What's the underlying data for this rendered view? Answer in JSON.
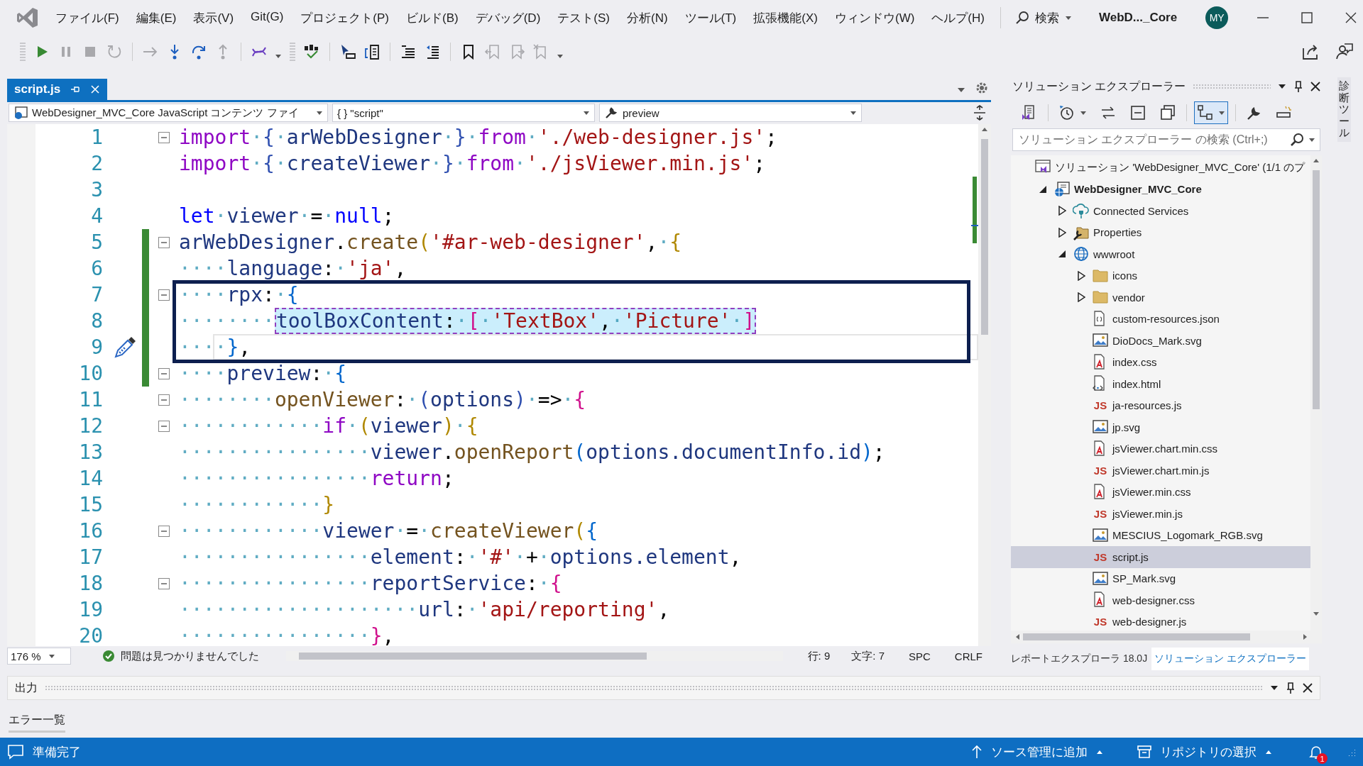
{
  "menu_bar": {
    "items": [
      "ファイル(F)",
      "編集(E)",
      "表示(V)",
      "Git(G)",
      "プロジェクト(P)",
      "ビルド(B)",
      "デバッグ(D)",
      "テスト(S)",
      "分析(N)",
      "ツール(T)",
      "拡張機能(X)",
      "ウィンドウ(W)",
      "ヘルプ(H)"
    ],
    "search": "検索",
    "title": "WebD..._Core",
    "avatar": "MY"
  },
  "toolbar": [
    {
      "disabled": false
    },
    {
      "disabled": true
    },
    {
      "disabled": true
    },
    {
      "disabled": true
    },
    {
      "disabled": true
    },
    {
      "disabled": false
    },
    {
      "disabled": false
    },
    {
      "disabled": true
    },
    {
      "disabled": false
    },
    {
      "disabled": false
    },
    {
      "disabled": false
    },
    {
      "disabled": false
    },
    {
      "disabled": false
    },
    {
      "disabled": false
    },
    {
      "disabled": false
    },
    {
      "disabled": true
    },
    {
      "disabled": true
    },
    {
      "disabled": true
    }
  ],
  "document_tab": {
    "label": "script.js",
    "selected": true
  },
  "navigation_bar": {
    "project": "WebDesigner_MVC_Core JavaScript コンテンツ ファイ",
    "scope": "{ } \"script\"",
    "member": "preview"
  },
  "code_lines": [
    {
      "number": "1",
      "fold": true,
      "changed": false,
      "highlight": false,
      "current": false,
      "tokens": [
        {
          "kind": "kw",
          "text": "import"
        },
        {
          "kind": "p",
          "text": "·"
        },
        {
          "kind": "b3",
          "text": "{"
        },
        {
          "kind": "id",
          "text": "·arWebDesigner·"
        },
        {
          "kind": "b3",
          "text": "}"
        },
        {
          "kind": "p",
          "text": "·"
        },
        {
          "kind": "kw",
          "text": "from"
        },
        {
          "kind": "p",
          "text": "·"
        },
        {
          "kind": "str",
          "text": "'./web-designer.js'"
        },
        {
          "kind": "p",
          "text": ";"
        }
      ]
    },
    {
      "number": "2",
      "fold": false,
      "changed": false,
      "highlight": false,
      "current": false,
      "tokens": [
        {
          "kind": "kw",
          "text": "import"
        },
        {
          "kind": "p",
          "text": "·"
        },
        {
          "kind": "b3",
          "text": "{"
        },
        {
          "kind": "id",
          "text": "·createViewer·"
        },
        {
          "kind": "b3",
          "text": "}"
        },
        {
          "kind": "p",
          "text": "·"
        },
        {
          "kind": "kw",
          "text": "from"
        },
        {
          "kind": "p",
          "text": "·"
        },
        {
          "kind": "str",
          "text": "'./jsViewer.min.js'"
        },
        {
          "kind": "p",
          "text": ";"
        }
      ]
    },
    {
      "number": "3",
      "fold": false,
      "changed": false,
      "highlight": false,
      "current": false
    },
    {
      "number": "4",
      "fold": false,
      "changed": false,
      "highlight": false,
      "current": false,
      "tokens": [
        {
          "kind": "kw2",
          "text": "let"
        },
        {
          "kind": "id",
          "text": "·viewer·"
        },
        {
          "kind": "p",
          "text": "=·"
        },
        {
          "kind": "kw2",
          "text": "null"
        },
        {
          "kind": "p",
          "text": ";"
        }
      ]
    },
    {
      "number": "5",
      "fold": true,
      "changed": true,
      "highlight": false,
      "current": false,
      "tokens": [
        {
          "kind": "id",
          "text": "arWebDesigner"
        },
        {
          "kind": "p",
          "text": "."
        },
        {
          "kind": "fn",
          "text": "create"
        },
        {
          "kind": "b1",
          "text": "("
        },
        {
          "kind": "str",
          "text": "'#ar-web-designer'"
        },
        {
          "kind": "p",
          "text": ",·"
        },
        {
          "kind": "b1",
          "text": "{"
        }
      ]
    },
    {
      "number": "6",
      "fold": false,
      "changed": true,
      "highlight": false,
      "current": false,
      "tokens": [
        {
          "kind": "ws",
          "text": "····"
        },
        {
          "kind": "id",
          "text": "language"
        },
        {
          "kind": "p",
          "text": ":·"
        },
        {
          "kind": "str",
          "text": "'ja'"
        },
        {
          "kind": "p",
          "text": ","
        }
      ]
    },
    {
      "number": "7",
      "fold": true,
      "changed": true,
      "highlight": false,
      "current": false,
      "tokens": [
        {
          "kind": "ws",
          "text": "····"
        },
        {
          "kind": "id",
          "text": "rpx"
        },
        {
          "kind": "p",
          "text": ":·"
        },
        {
          "kind": "b2",
          "text": "{"
        }
      ]
    },
    {
      "number": "8",
      "fold": false,
      "changed": true,
      "highlight": true,
      "current": false,
      "tokens": [
        {
          "kind": "ws",
          "text": "········"
        },
        {
          "kind": "id",
          "text": "toolBoxContent"
        },
        {
          "kind": "p",
          "text": ":·"
        },
        {
          "kind": "b4",
          "text": "["
        },
        {
          "kind": "p",
          "text": "·"
        },
        {
          "kind": "str",
          "text": "'TextBox'"
        },
        {
          "kind": "p",
          "text": ",·"
        },
        {
          "kind": "str",
          "text": "'Picture'"
        },
        {
          "kind": "p",
          "text": "·"
        },
        {
          "kind": "b4",
          "text": "]"
        }
      ]
    },
    {
      "number": "9",
      "fold": false,
      "changed": true,
      "highlight": false,
      "current": true,
      "tokens": [
        {
          "kind": "ws",
          "text": "····"
        },
        {
          "kind": "b2",
          "text": "}"
        },
        {
          "kind": "p",
          "text": ","
        }
      ]
    },
    {
      "number": "10",
      "fold": true,
      "changed": true,
      "highlight": false,
      "current": false,
      "tokens": [
        {
          "kind": "ws",
          "text": "····"
        },
        {
          "kind": "id",
          "text": "preview"
        },
        {
          "kind": "p",
          "text": ":·"
        },
        {
          "kind": "b2",
          "text": "{"
        }
      ]
    },
    {
      "number": "11",
      "fold": true,
      "changed": false,
      "highlight": false,
      "current": false,
      "tokens": [
        {
          "kind": "ws",
          "text": "········"
        },
        {
          "kind": "fn",
          "text": "openViewer"
        },
        {
          "kind": "p",
          "text": ":·"
        },
        {
          "kind": "b3",
          "text": "("
        },
        {
          "kind": "id",
          "text": "options"
        },
        {
          "kind": "b3",
          "text": ")"
        },
        {
          "kind": "p",
          "text": "·=>·"
        },
        {
          "kind": "b4",
          "text": "{"
        }
      ]
    },
    {
      "number": "12",
      "fold": true,
      "changed": false,
      "highlight": false,
      "current": false,
      "tokens": [
        {
          "kind": "ws",
          "text": "············"
        },
        {
          "kind": "kw",
          "text": "if"
        },
        {
          "kind": "p",
          "text": "·"
        },
        {
          "kind": "b1",
          "text": "("
        },
        {
          "kind": "id",
          "text": "viewer"
        },
        {
          "kind": "b1",
          "text": ")"
        },
        {
          "kind": "p",
          "text": "·"
        },
        {
          "kind": "b1",
          "text": "{"
        }
      ]
    },
    {
      "number": "13",
      "fold": false,
      "changed": false,
      "highlight": false,
      "current": false,
      "tokens": [
        {
          "kind": "ws",
          "text": "················"
        },
        {
          "kind": "id",
          "text": "viewer"
        },
        {
          "kind": "p",
          "text": "."
        },
        {
          "kind": "fn",
          "text": "openReport"
        },
        {
          "kind": "b2",
          "text": "("
        },
        {
          "kind": "id",
          "text": "options.documentInfo.id"
        },
        {
          "kind": "b2",
          "text": ")"
        },
        {
          "kind": "p",
          "text": ";"
        }
      ]
    },
    {
      "number": "14",
      "fold": false,
      "changed": false,
      "highlight": false,
      "current": false,
      "tokens": [
        {
          "kind": "ws",
          "text": "················"
        },
        {
          "kind": "kw",
          "text": "return"
        },
        {
          "kind": "p",
          "text": ";"
        }
      ]
    },
    {
      "number": "15",
      "fold": false,
      "changed": false,
      "highlight": false,
      "current": false,
      "tokens": [
        {
          "kind": "ws",
          "text": "············"
        },
        {
          "kind": "b1",
          "text": "}"
        }
      ]
    },
    {
      "number": "16",
      "fold": true,
      "changed": false,
      "highlight": false,
      "current": false,
      "tokens": [
        {
          "kind": "ws",
          "text": "············"
        },
        {
          "kind": "id",
          "text": "viewer"
        },
        {
          "kind": "p",
          "text": "·=·"
        },
        {
          "kind": "fn",
          "text": "createViewer"
        },
        {
          "kind": "b1",
          "text": "("
        },
        {
          "kind": "b2",
          "text": "{"
        }
      ]
    },
    {
      "number": "17",
      "fold": false,
      "changed": false,
      "highlight": false,
      "current": false,
      "tokens": [
        {
          "kind": "ws",
          "text": "················"
        },
        {
          "kind": "id",
          "text": "element"
        },
        {
          "kind": "p",
          "text": ":·"
        },
        {
          "kind": "str",
          "text": "'#'"
        },
        {
          "kind": "p",
          "text": "·+·"
        },
        {
          "kind": "id",
          "text": "options.element"
        },
        {
          "kind": "p",
          "text": ","
        }
      ]
    },
    {
      "number": "18",
      "fold": true,
      "changed": false,
      "highlight": false,
      "current": false,
      "tokens": [
        {
          "kind": "ws",
          "text": "················"
        },
        {
          "kind": "id",
          "text": "reportService"
        },
        {
          "kind": "p",
          "text": ":·"
        },
        {
          "kind": "b4",
          "text": "{"
        }
      ]
    },
    {
      "number": "19",
      "fold": false,
      "changed": false,
      "highlight": false,
      "current": false,
      "tokens": [
        {
          "kind": "ws",
          "text": "····················"
        },
        {
          "kind": "id",
          "text": "url"
        },
        {
          "kind": "p",
          "text": ":·"
        },
        {
          "kind": "str",
          "text": "'api/reporting'"
        },
        {
          "kind": "p",
          "text": ","
        }
      ]
    },
    {
      "number": "20",
      "fold": false,
      "changed": false,
      "highlight": false,
      "current": false,
      "tokens": [
        {
          "kind": "ws",
          "text": "················"
        },
        {
          "kind": "b4",
          "text": "}"
        },
        {
          "kind": "p",
          "text": ","
        }
      ]
    }
  ],
  "editor_status": {
    "zoom": "176 %",
    "issues": "問題は見つかりませんでした",
    "line": "行: 9",
    "column": "文字: 7",
    "indent": "SPC",
    "line_ending": "CRLF"
  },
  "solution_explorer": {
    "title": "ソリューション エクスプローラー",
    "toolbar": [
      {
        "on": false
      },
      {
        "on": false
      },
      {
        "on": false
      },
      {
        "on": false
      },
      {
        "on": false
      },
      {
        "on": true
      },
      {
        "on": false
      },
      {
        "on": false
      }
    ],
    "search": {
      "placeholder": "ソリューション エクスプローラー の検索 (Ctrl+;)"
    },
    "tree": [
      {
        "label": "ソリューション 'WebDesigner_MVC_Core' (1/1 のプ",
        "kind": "solution",
        "selected": false,
        "children": [
          {
            "label": "WebDesigner_MVC_Core",
            "kind": "project",
            "expanded": true,
            "selected": false,
            "children": [
              {
                "label": "Connected Services",
                "kind": "connected",
                "expanded": false,
                "selected": false
              },
              {
                "label": "Properties",
                "kind": "properties",
                "expanded": false,
                "selected": false
              },
              {
                "label": "wwwroot",
                "kind": "web",
                "expanded": true,
                "selected": false,
                "children": [
                  {
                    "label": "icons",
                    "kind": "folder",
                    "expanded": false,
                    "selected": false
                  },
                  {
                    "label": "vendor",
                    "kind": "folder",
                    "expanded": false,
                    "selected": false
                  },
                  {
                    "label": "custom-resources.json",
                    "kind": "json",
                    "selected": false
                  },
                  {
                    "label": "DioDocs_Mark.svg",
                    "kind": "image",
                    "selected": false
                  },
                  {
                    "label": "index.css",
                    "kind": "css",
                    "selected": false
                  },
                  {
                    "label": "index.html",
                    "kind": "html",
                    "selected": false
                  },
                  {
                    "label": "ja-resources.js",
                    "kind": "js",
                    "icon_text": "JS",
                    "selected": false
                  },
                  {
                    "label": "jp.svg",
                    "kind": "image",
                    "selected": false
                  },
                  {
                    "label": "jsViewer.chart.min.css",
                    "kind": "css",
                    "selected": false
                  },
                  {
                    "label": "jsViewer.chart.min.js",
                    "kind": "js",
                    "icon_text": "JS",
                    "selected": false
                  },
                  {
                    "label": "jsViewer.min.css",
                    "kind": "css",
                    "selected": false
                  },
                  {
                    "label": "jsViewer.min.js",
                    "kind": "js",
                    "icon_text": "JS",
                    "selected": false
                  },
                  {
                    "label": "MESCIUS_Logomark_RGB.svg",
                    "kind": "image",
                    "selected": false
                  },
                  {
                    "label": "script.js",
                    "kind": "js",
                    "icon_text": "JS",
                    "selected": true
                  },
                  {
                    "label": "SP_Mark.svg",
                    "kind": "image",
                    "selected": false
                  },
                  {
                    "label": "web-designer.css",
                    "kind": "css",
                    "selected": false
                  },
                  {
                    "label": "web-designer.js",
                    "kind": "js",
                    "icon_text": "JS",
                    "selected": false
                  }
                ]
              }
            ]
          }
        ]
      }
    ],
    "tabs": [
      {
        "label": "レポートエクスプローラ 18.0J",
        "selected": false
      },
      {
        "label": "ソリューション エクスプローラー",
        "selected": true
      }
    ]
  },
  "side_tab": "診断ツール",
  "output_panel": {
    "title": "出力"
  },
  "error_list_tab": "エラー一覧",
  "status_bar": {
    "message": "準備完了",
    "add_source_control": "ソース管理に追加",
    "select_repository": "リポジトリの選択",
    "notifications": "1"
  }
}
